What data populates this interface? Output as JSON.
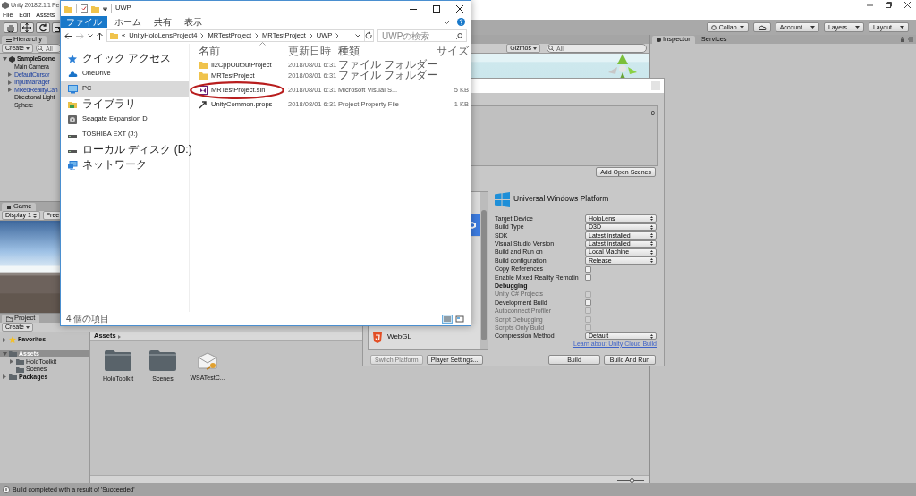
{
  "unity": {
    "title": "Unity 2018.2.1f1 Pe",
    "menu": [
      "File",
      "Edit",
      "Assets"
    ],
    "tools": [
      {
        "kind": "hand"
      },
      {
        "kind": "move"
      },
      {
        "kind": "rotate"
      },
      {
        "kind": "scale"
      }
    ],
    "toolbar_right": [
      {
        "kind": "collab",
        "label": "Collab"
      },
      {
        "kind": "cloud"
      },
      {
        "kind": "dropdown",
        "label": "Account"
      },
      {
        "kind": "dropdown",
        "label": "Layers"
      },
      {
        "kind": "dropdown",
        "label": "Layout"
      }
    ]
  },
  "hierarchy": {
    "tab": "Hierarchy",
    "create": "Create",
    "search_placeholder": "All",
    "items": [
      {
        "label": "SampleScene",
        "kind": "scene",
        "expanded": true,
        "children": [
          {
            "label": "Main Camera",
            "kind": "object"
          },
          {
            "label": "DefaultCursor",
            "kind": "prefab",
            "expanded": false
          },
          {
            "label": "InputManager",
            "kind": "prefab",
            "expanded": false
          },
          {
            "label": "MixedRealityCan",
            "kind": "prefab",
            "expanded": false
          },
          {
            "label": "Directional Light",
            "kind": "object"
          },
          {
            "label": "Sphere",
            "kind": "object"
          }
        ]
      }
    ]
  },
  "game": {
    "tab": "Game",
    "display": "Display 1",
    "aspect": "Free"
  },
  "scene": {
    "gizmos": "Gizmos",
    "search_placeholder": "All"
  },
  "inspector": {
    "tabs": [
      {
        "label": "Inspector",
        "selected": true
      },
      {
        "label": "Services",
        "selected": false
      }
    ]
  },
  "project": {
    "tab": "Project",
    "create": "Create",
    "tree": [
      {
        "label": "Favorites",
        "kind": "favorites",
        "expanded": false,
        "selected": false
      },
      {
        "label": "Assets",
        "kind": "folder",
        "expanded": true,
        "selected": true,
        "children": [
          {
            "label": "HoloToolkit",
            "kind": "folder",
            "expanded": false,
            "selected": false
          },
          {
            "label": "Scenes",
            "kind": "folder",
            "selected": false
          }
        ]
      },
      {
        "label": "Packages",
        "kind": "folder",
        "expanded": false,
        "selected": false
      }
    ],
    "breadcrumb": "Assets",
    "assets": [
      {
        "label": "HoloToolkit",
        "kind": "folder"
      },
      {
        "label": "Scenes",
        "kind": "folder"
      },
      {
        "label": "WSATestC...",
        "kind": "asset"
      }
    ],
    "zoom": {
      "level": 0.55
    }
  },
  "status_bar": "Build completed with a result of 'Succeeded'",
  "build_settings": {
    "scene_count": "0",
    "add_open_scenes": "Add Open Scenes",
    "platforms": [
      {
        "kind": "unity",
        "selected": true
      },
      {
        "kind": "html5",
        "label": "WebGL",
        "selected": false
      }
    ],
    "platform_title": "Universal Windows Platform",
    "settings": [
      {
        "kind": "dropdown",
        "label": "Target Device",
        "value": "HoloLens"
      },
      {
        "kind": "dropdown",
        "label": "Build Type",
        "value": "D3D"
      },
      {
        "kind": "dropdown",
        "label": "SDK",
        "value": "Latest installed"
      },
      {
        "kind": "dropdown",
        "label": "Visual Studio Version",
        "value": "Latest installed"
      },
      {
        "kind": "dropdown",
        "label": "Build and Run on",
        "value": "Local Machine"
      },
      {
        "kind": "dropdown",
        "label": "Build configuration",
        "value": "Release"
      },
      {
        "kind": "checkbox",
        "label": "Copy References",
        "checked": false,
        "disabled": false
      },
      {
        "kind": "checkbox",
        "label": "Enable Mixed Reality Remotin",
        "checked": false,
        "disabled": false
      },
      {
        "kind": "header",
        "label": "Debugging"
      },
      {
        "kind": "checkbox",
        "label": "Unity C# Projects",
        "checked": false,
        "disabled": true
      },
      {
        "kind": "checkbox",
        "label": "Development Build",
        "checked": false,
        "disabled": false
      },
      {
        "kind": "checkbox",
        "label": "Autoconnect Profiler",
        "checked": false,
        "disabled": true
      },
      {
        "kind": "checkbox",
        "label": "Script Debugging",
        "checked": false,
        "disabled": true
      },
      {
        "kind": "checkbox",
        "label": "Scripts Only Build",
        "checked": false,
        "disabled": true
      },
      {
        "kind": "dropdown",
        "label": "Compression Method",
        "value": "Default"
      }
    ],
    "cloud_link": "Learn about Unity Cloud Build",
    "buttons": [
      {
        "label": "Switch Platform",
        "disabled": true
      },
      {
        "label": "Player Settings...",
        "disabled": false
      }
    ],
    "build_buttons": [
      "Build",
      "Build And Run"
    ]
  },
  "explorer": {
    "title": "UWP",
    "ribbon_tabs": [
      {
        "label": "ファイル",
        "selected": true
      },
      {
        "label": "ホーム",
        "selected": false
      },
      {
        "label": "共有",
        "selected": false
      },
      {
        "label": "表示",
        "selected": false
      }
    ],
    "path_overflow": "«",
    "path": [
      "UnityHoloLensProject4",
      "MRTestProject",
      "MRTestProject",
      "UWP"
    ],
    "search_placeholder": "UWPの検索",
    "nav": [
      {
        "label": "クイック アクセス",
        "kind": "star",
        "selected": false
      },
      {
        "label": "OneDrive",
        "kind": "cloud",
        "selected": false
      },
      {
        "label": "PC",
        "kind": "pc",
        "selected": true
      },
      {
        "label": "ライブラリ",
        "kind": "library",
        "selected": false
      },
      {
        "label": "Seagate Expansion Di",
        "kind": "disk",
        "selected": false
      },
      {
        "label": "TOSHIBA EXT (J:)",
        "kind": "drive",
        "selected": false
      },
      {
        "label": "ローカル ディスク (D:)",
        "kind": "drive",
        "selected": false
      },
      {
        "label": "ネットワーク",
        "kind": "network",
        "selected": false
      }
    ],
    "columns": [
      "名前",
      "更新日時",
      "種類",
      "サイズ"
    ],
    "files": [
      {
        "name": "Il2CppOutputProject",
        "date": "2018/08/01 6:31",
        "type": "ファイル フォルダー",
        "kind": "folder",
        "circled": false
      },
      {
        "name": "MRTestProject",
        "date": "2018/08/01 6:31",
        "type": "ファイル フォルダー",
        "kind": "folder",
        "circled": false
      },
      {
        "name": "MRTestProject.sln",
        "date": "2018/08/01 6:31",
        "type": "Microsoft Visual S...",
        "size": "5 KB",
        "kind": "solution",
        "circled": true
      },
      {
        "name": "UnityCommon.props",
        "date": "2018/08/01 6:31",
        "type": "Project Property File",
        "size": "1 KB",
        "kind": "props",
        "circled": false
      }
    ],
    "status": "4 個の項目"
  }
}
